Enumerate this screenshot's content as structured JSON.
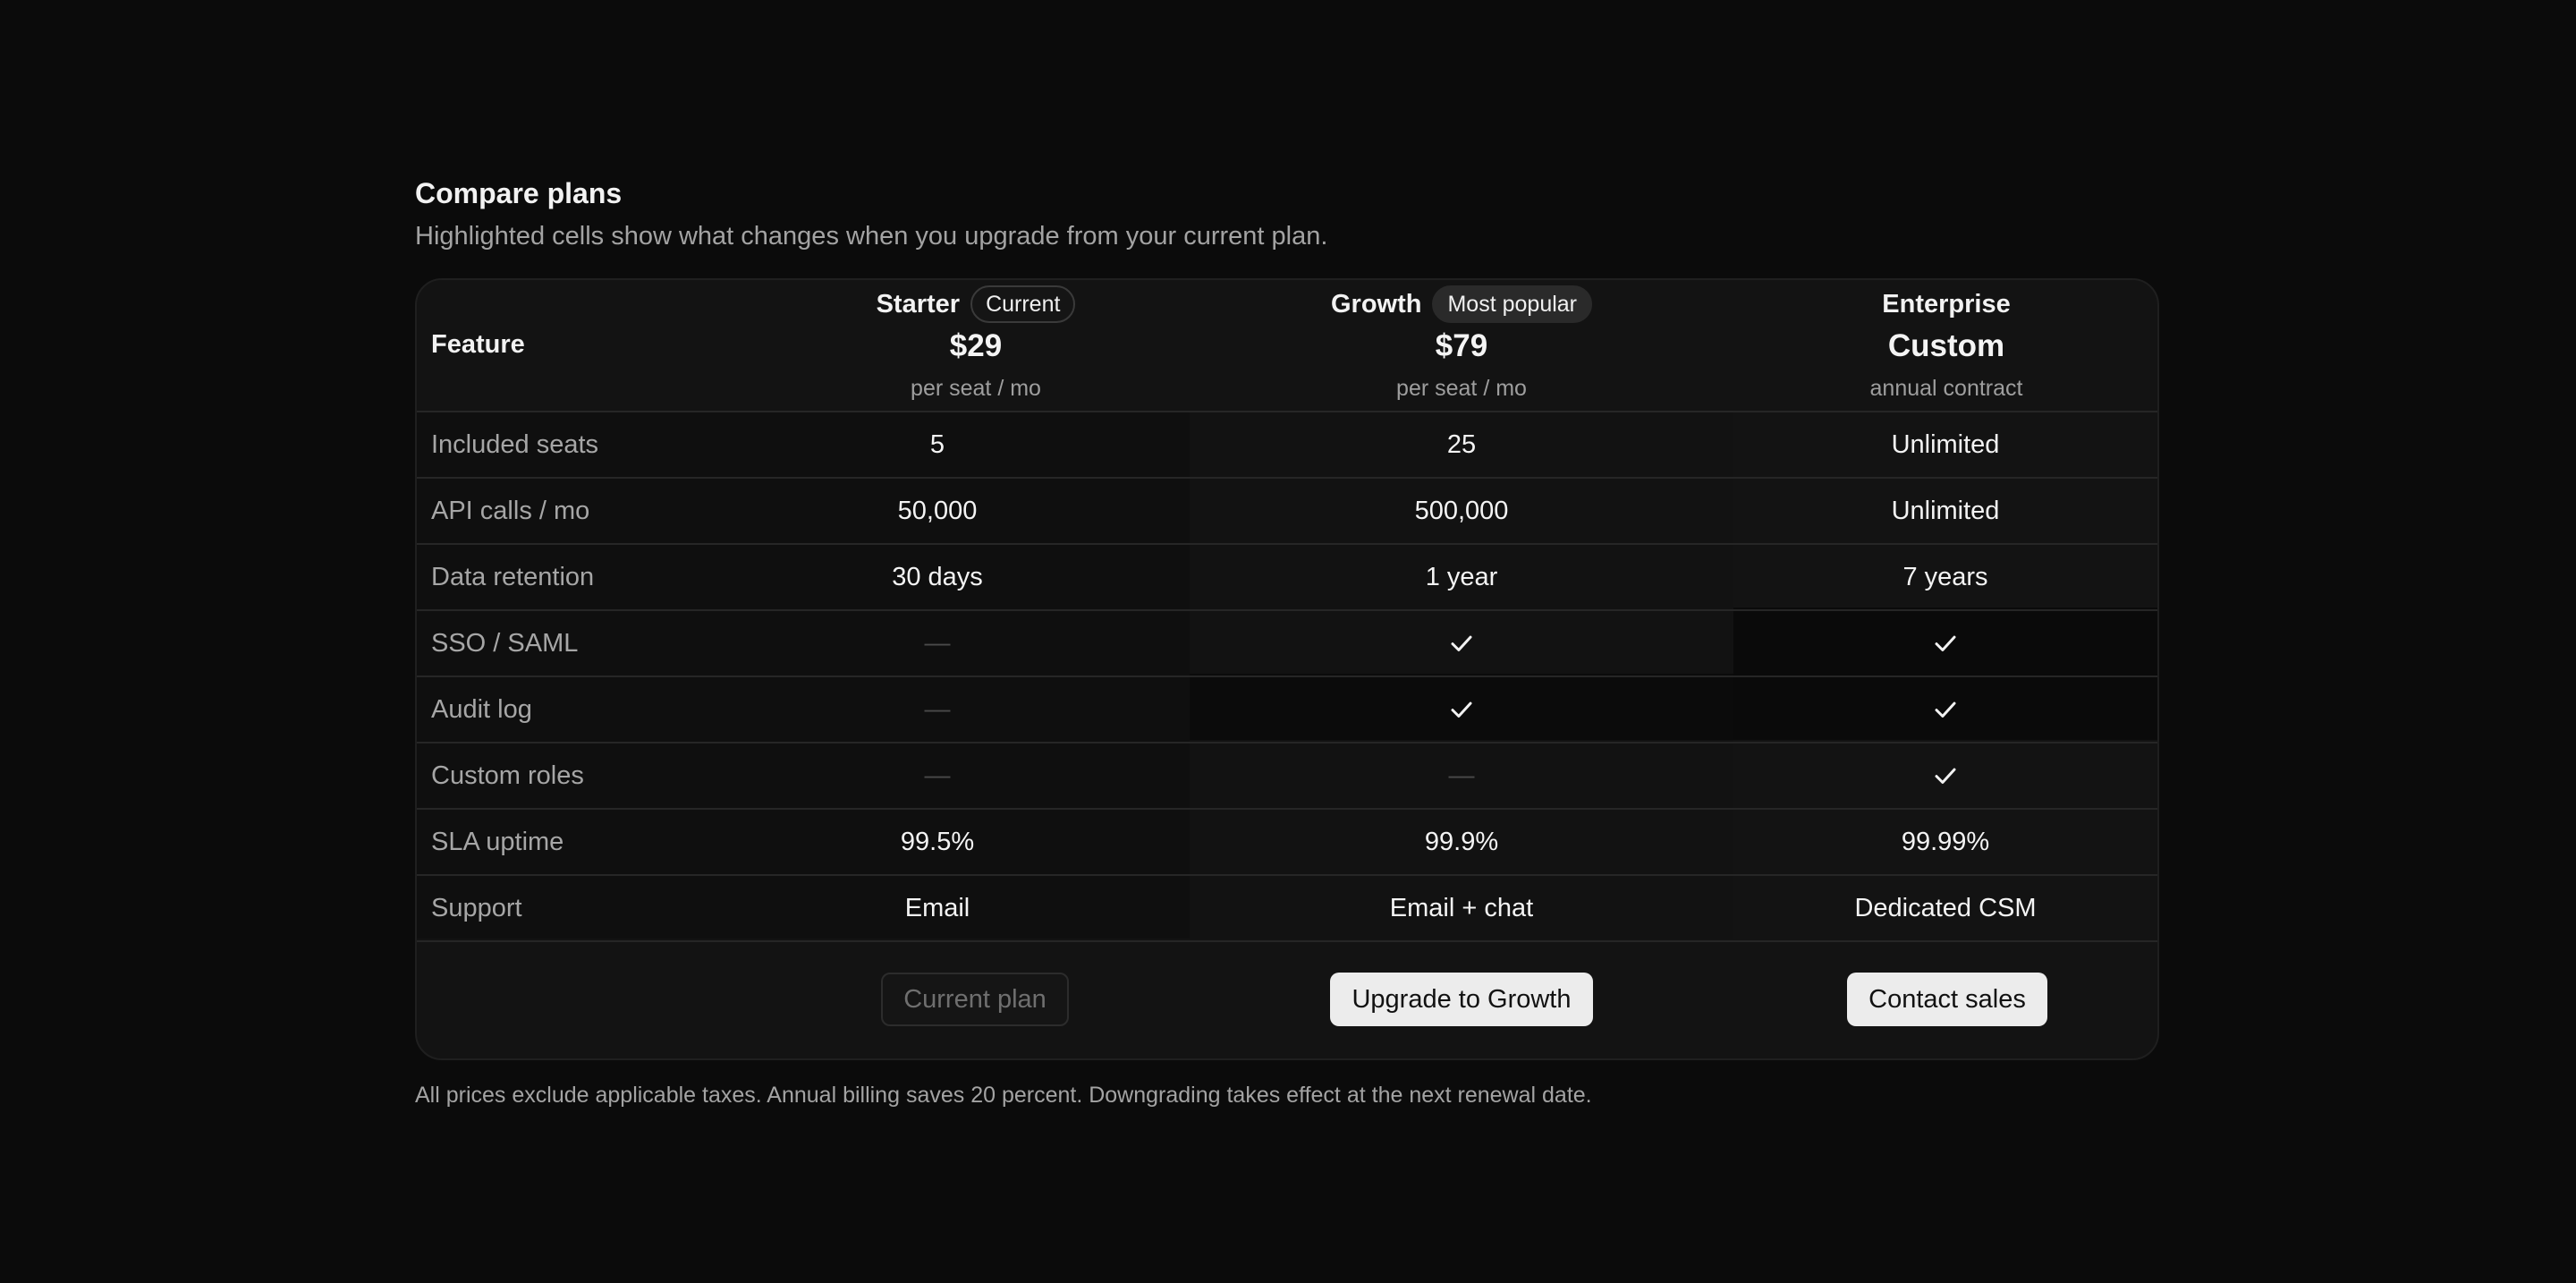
{
  "header": {
    "title": "Compare plans",
    "subtitle": "Highlighted cells show what changes when you upgrade from your current plan."
  },
  "table": {
    "feature_header": "Feature",
    "plans": [
      {
        "name": "Starter",
        "badge": "Current",
        "price": "$29",
        "period": "per seat / mo"
      },
      {
        "name": "Growth",
        "badge": "Most popular",
        "price": "$79",
        "period": "per seat / mo"
      },
      {
        "name": "Enterprise",
        "badge": "",
        "price": "Custom",
        "period": "annual contract"
      }
    ],
    "rows": [
      {
        "label": "Included seats",
        "values": [
          "5",
          "25",
          "Unlimited"
        ]
      },
      {
        "label": "API calls / mo",
        "values": [
          "50,000",
          "500,000",
          "Unlimited"
        ]
      },
      {
        "label": "Data retention",
        "values": [
          "30 days",
          "1 year",
          "7 years"
        ]
      },
      {
        "label": "SSO / SAML",
        "values": [
          "—",
          "check",
          "check"
        ]
      },
      {
        "label": "Audit log",
        "values": [
          "—",
          "check",
          "check"
        ]
      },
      {
        "label": "Custom roles",
        "values": [
          "—",
          "—",
          "check"
        ]
      },
      {
        "label": "SLA uptime",
        "values": [
          "99.5%",
          "99.9%",
          "99.99%"
        ]
      },
      {
        "label": "Support",
        "values": [
          "Email",
          "Email + chat",
          "Dedicated CSM"
        ]
      }
    ],
    "actions": [
      "Current plan",
      "Upgrade to Growth",
      "Contact sales"
    ]
  },
  "footnote": "All prices exclude applicable taxes. Annual billing saves 20 percent. Downgrading takes effect at the next renewal date.",
  "icons": {
    "included": "checkmark-icon",
    "not_included": "dash"
  },
  "colors": {
    "background": "#0b0b0b",
    "card": "#131313",
    "unchanged_cell": "#0e0e0e",
    "button_primary": "#ececec",
    "text": "#f4f4f4",
    "muted_text": "#a6a6a6"
  }
}
